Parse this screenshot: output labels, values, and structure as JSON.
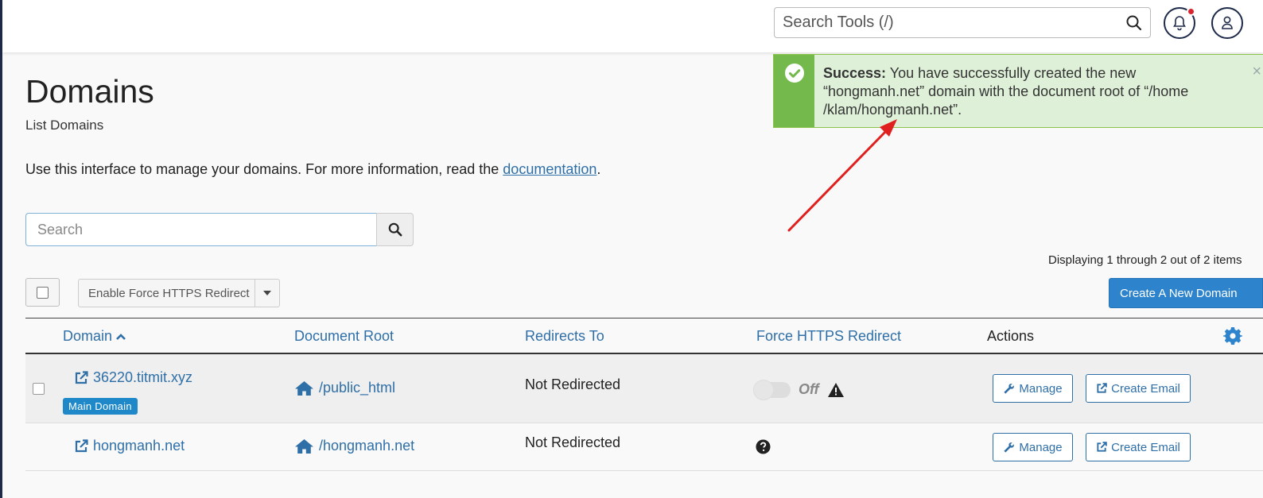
{
  "header": {
    "search_placeholder": "Search Tools (/)",
    "notification_badge": true
  },
  "page": {
    "title": "Domains",
    "subtitle": "List Domains",
    "intro_text": "Use this interface to manage your domains. For more information, read the ",
    "intro_link": "documentation",
    "intro_end": "."
  },
  "search": {
    "placeholder": "Search"
  },
  "alert": {
    "label": "Success:",
    "message": " You have successfully created the new “hongmanh.net” domain with the document root of “/home /klam/hongmanh.net”.",
    "close": "×"
  },
  "toolbar": {
    "force_https_label": "Enable Force HTTPS Redirect",
    "create_label": "Create A New Domain",
    "display_count": "Displaying 1 through 2 out of 2 items"
  },
  "table": {
    "headers": {
      "domain": "Domain",
      "document_root": "Document Root",
      "redirects_to": "Redirects To",
      "force_https": "Force HTTPS Redirect",
      "actions": "Actions"
    },
    "rows": [
      {
        "domain": "36220.titmit.xyz",
        "badge": "Main Domain",
        "document_root": "/public_html",
        "redirects_to": "Not Redirected",
        "force_https": "Off",
        "manage": "Manage",
        "create_email": "Create Email"
      },
      {
        "domain": "hongmanh.net",
        "document_root": "/hongmanh.net",
        "redirects_to": "Not Redirected",
        "manage": "Manage",
        "create_email": "Create Email"
      }
    ]
  },
  "colors": {
    "link": "#2f6fa7",
    "primary_button": "#2d83cc",
    "success_bg": "#dff0d8",
    "success_strip": "#73b94c",
    "annotation_arrow": "#e0201e"
  }
}
